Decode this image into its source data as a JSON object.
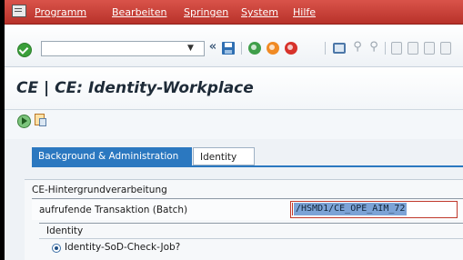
{
  "menubar": {
    "items": [
      "Programm",
      "Bearbeiten",
      "Springen",
      "System",
      "Hilfe"
    ]
  },
  "toolbar": {
    "command_value": "",
    "nav_back_glyph": "«"
  },
  "page": {
    "title": "CE | CE: Identity-Workplace"
  },
  "tabs": [
    {
      "label": "Background & Administration",
      "active": true
    },
    {
      "label": "Identity",
      "active": false
    }
  ],
  "form": {
    "group_title": "CE-Hintergrundverarbeitung",
    "transaction_label": "aufrufende Transaktion (Batch)",
    "transaction_value": "/HSMD1/CE_OPE_AIM_72",
    "subgroup_title": "Identity",
    "radio_label": "Identity-SoD-Check-Job?",
    "radio_selected": true
  },
  "colors": {
    "menubar": "#c0392b",
    "active_tab": "#2b78c0",
    "selection": "#7ca3d6"
  }
}
